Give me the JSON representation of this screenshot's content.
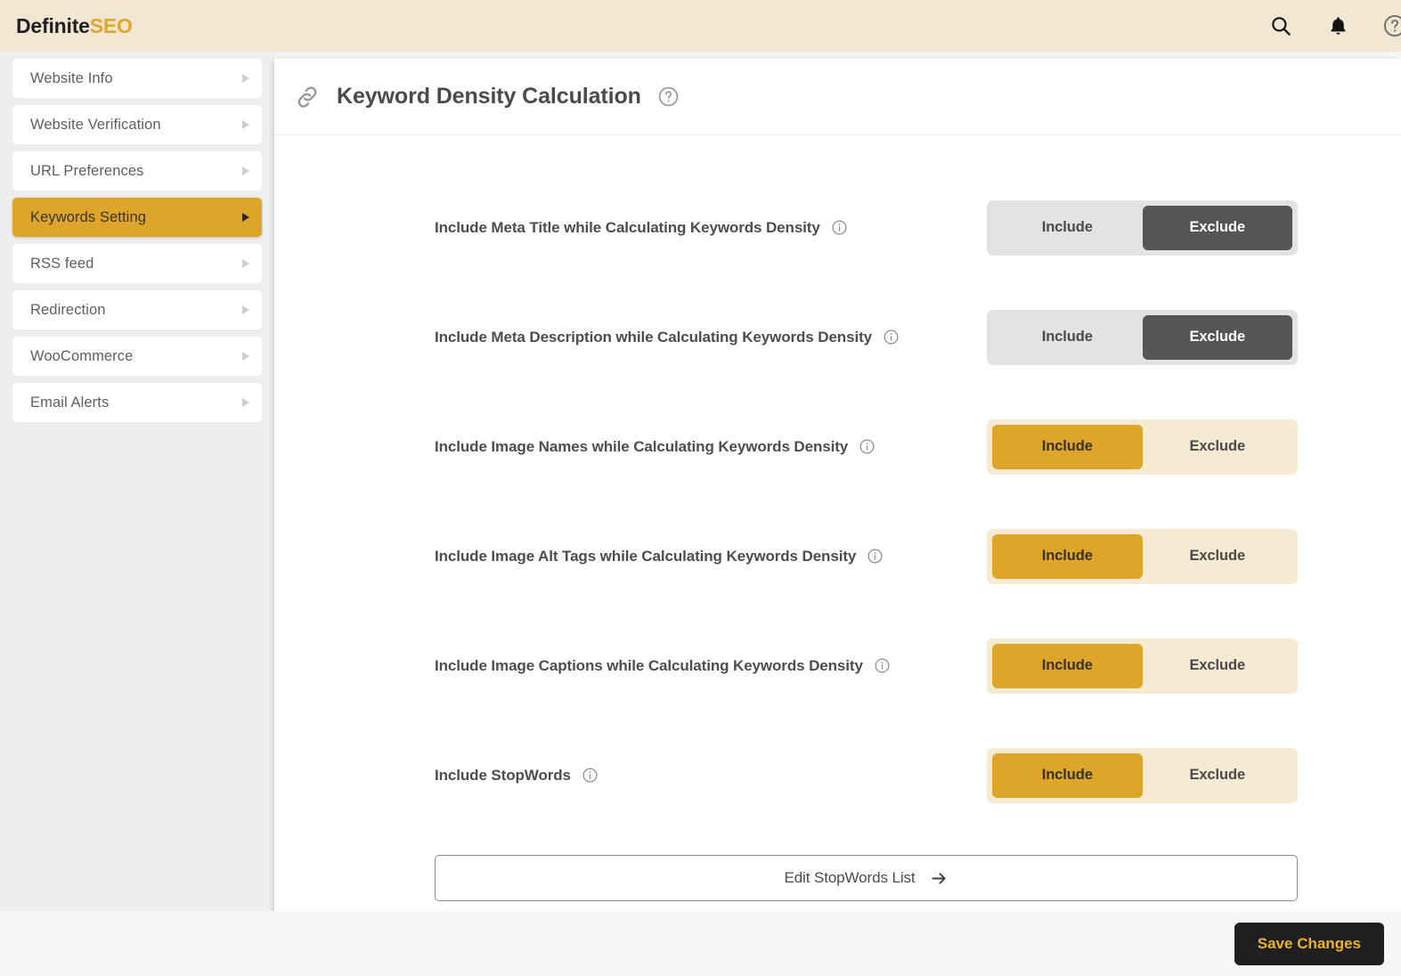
{
  "header": {
    "brand_primary": "Definite",
    "brand_accent": "SEO",
    "icons": [
      "search-icon",
      "bell-icon",
      "help-circle-icon"
    ]
  },
  "sidebar": {
    "items": [
      {
        "label": "Website Info",
        "active": false
      },
      {
        "label": "Website Verification",
        "active": false
      },
      {
        "label": "URL Preferences",
        "active": false
      },
      {
        "label": "Keywords Setting",
        "active": true
      },
      {
        "label": "RSS feed",
        "active": false
      },
      {
        "label": "Redirection",
        "active": false
      },
      {
        "label": "WooCommerce",
        "active": false
      },
      {
        "label": "Email Alerts",
        "active": false
      }
    ]
  },
  "panel": {
    "title": "Keyword Density Calculation",
    "title_icon": "link-icon",
    "help_icon": "help-circle-icon",
    "rows": [
      {
        "label": "Include Meta Title while Calculating Keywords Density",
        "include_label": "Include",
        "exclude_label": "Exclude",
        "selected": "Exclude"
      },
      {
        "label": "Include Meta Description while Calculating Keywords Density",
        "include_label": "Include",
        "exclude_label": "Exclude",
        "selected": "Exclude"
      },
      {
        "label": "Include Image Names while Calculating Keywords Density",
        "include_label": "Include",
        "exclude_label": "Exclude",
        "selected": "Include"
      },
      {
        "label": "Include Image Alt Tags while Calculating Keywords Density",
        "include_label": "Include",
        "exclude_label": "Exclude",
        "selected": "Include"
      },
      {
        "label": "Include Image Captions while Calculating Keywords Density",
        "include_label": "Include",
        "exclude_label": "Exclude",
        "selected": "Include"
      },
      {
        "label": "Include StopWords",
        "include_label": "Include",
        "exclude_label": "Exclude",
        "selected": "Include"
      }
    ],
    "stopwords_button": {
      "label": "Edit StopWords List",
      "icon": "arrow-right-icon"
    }
  },
  "footer": {
    "save_label": "Save Changes"
  },
  "colors": {
    "header_bg": "#f0e6d2",
    "accent_gold": "#dda62b",
    "accent_gold_text": "#eeb32a",
    "sidebar_bg": "#eeeeee",
    "toggle_exclude_track": "#e3e3e3",
    "toggle_exclude_pill": "#555555",
    "toggle_include_track": "#f6ead2",
    "save_bg": "#1f1f1f"
  }
}
